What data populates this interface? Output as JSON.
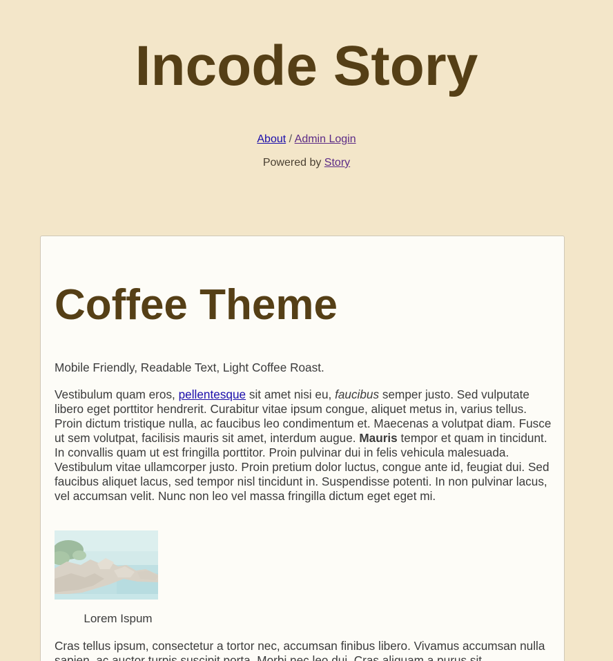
{
  "site": {
    "title": "Incode Story"
  },
  "nav": {
    "about_label": "About",
    "separator": "/",
    "admin_login_label": "Admin Login"
  },
  "footer_line": {
    "prefix": "Powered by",
    "link_label": "Story"
  },
  "post": {
    "title": "Coffee Theme",
    "intro": "Mobile Friendly, Readable Text, Light Coffee Roast.",
    "para2": {
      "before_link": "Vestibulum quam eros, ",
      "link_text": "pellentesque",
      "after_link": " sit amet nisi eu, ",
      "emphasis": "faucibus",
      "after_emphasis": " semper justo. Sed vulputate libero eget porttitor hendrerit. Curabitur vitae ipsum congue, aliquet metus in, varius tellus. Proin dictum tristique nulla, ac faucibus leo condimentum et. Maecenas a volutpat diam. Fusce ut sem volutpat, facilisis mauris sit amet, interdum augue. ",
      "strong": "Mauris",
      "after_strong": " tempor et quam in tincidunt. In convallis quam ut est fringilla porttitor. Proin pulvinar dui in felis vehicula malesuada. Vestibulum vitae ullamcorper justo. Proin pretium dolor luctus, congue ante id, feugiat dui. Sed faucibus aliquet lacus, sed tempor nisl tincidunt in. Suspendisse potenti. In non pulvinar lacus, vel accumsan velit. Nunc non leo vel massa fringilla dictum eget eget mi."
    },
    "figure_caption": "Lorem Ispum",
    "para3": "Cras tellus ipsum, consectetur a tortor nec, accumsan finibus libero. Vivamus accumsan nulla sapien, ac auctor turpis suscipit porta. Morbi nec leo dui. Cras aliquam a purus sit"
  },
  "colors": {
    "page_background": "#f3e6c9",
    "heading_brown": "#553f16",
    "card_background": "#fdfcf7",
    "link_blue": "#1a0dab",
    "link_visited": "#5b2a86"
  },
  "icons": {
    "figure_image": "seaside-rocks-photo"
  }
}
